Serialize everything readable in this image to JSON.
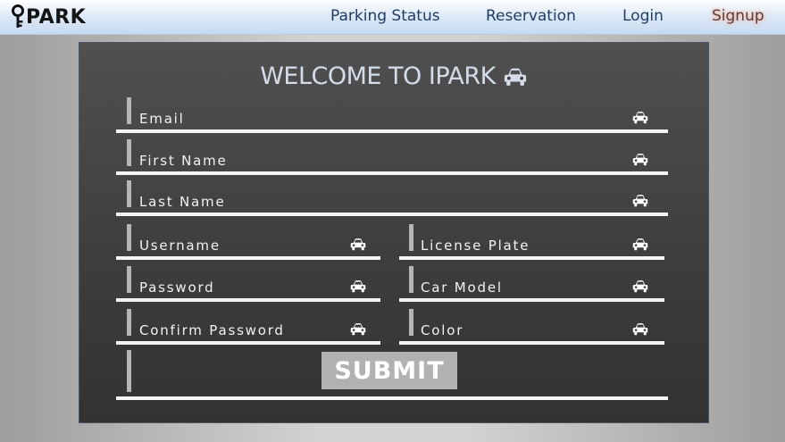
{
  "app": {
    "logo_text": "PARK"
  },
  "nav": {
    "items": [
      {
        "label": "Parking Status"
      },
      {
        "label": "Reservation"
      },
      {
        "label": "Login"
      },
      {
        "label": "Signup",
        "active": true
      }
    ],
    "active_highlight_color": "#f2b49c"
  },
  "form": {
    "title": "WELCOME TO IPARK",
    "fields": {
      "email": "Email",
      "first_name": "First Name",
      "last_name": "Last Name",
      "username": "Username",
      "password": "Password",
      "confirm_password": "Confirm Password",
      "license_plate": "License Plate",
      "car_model": "Car Model",
      "color": "Color"
    },
    "submit_label": "SUBMIT",
    "field_icon": "car-icon"
  }
}
